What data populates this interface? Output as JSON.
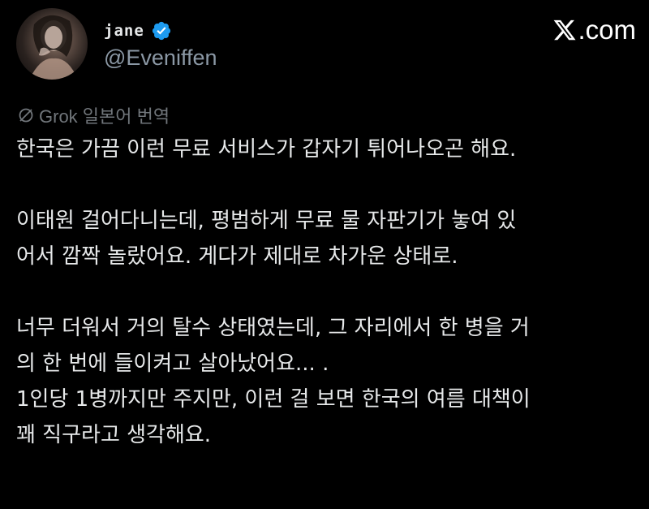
{
  "author": {
    "display_name": "jane",
    "handle": "@Eveniffen",
    "avatar_icon": "profile-photo",
    "verified_icon": "verified-badge-icon"
  },
  "brand": {
    "logo_text": ".com",
    "logo_icon": "x-logo-icon"
  },
  "translation": {
    "label": "Grok 일본어 번역",
    "icon": "translate-icon"
  },
  "tweet": {
    "lines": [
      "한국은 가끔 이런 무료 서비스가 갑자기 튀어나오곤 해요.",
      "이태원 걸어다니는데, 평범하게 무료 물 자판기가 놓여 있",
      "어서 깜짝 놀랐어요. 게다가 제대로 차가운 상태로.",
      "너무 더워서 거의 탈수 상태였는데, 그 자리에서 한 병을 거",
      "의 한 번에 들이켜고 살아났어요... .",
      "1인당 1병까지만 주지만, 이런 걸 보면 한국의 여름 대책이",
      "꽤 직구라고 생각해요."
    ]
  },
  "colors": {
    "background": "#000000",
    "text": "#e7e9ea",
    "secondary": "#8b98a5",
    "muted": "#71767b",
    "verified": "#1d9bf0"
  }
}
